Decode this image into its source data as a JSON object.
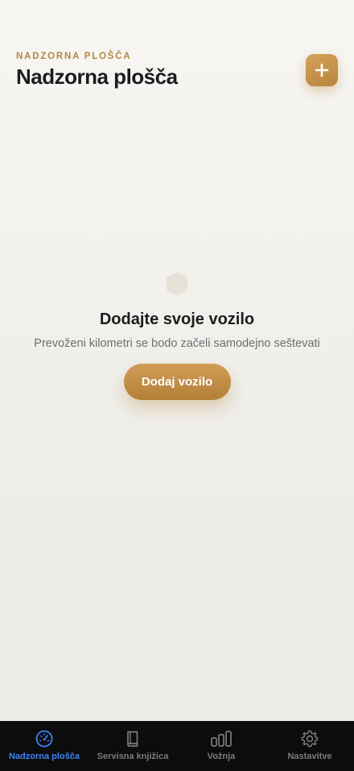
{
  "header": {
    "eyebrow": "NADZORNA PLOŠČA",
    "title": "Nadzorna plošča",
    "add_icon": "plus-icon"
  },
  "empty_state": {
    "icon": "hexagon-icon",
    "title": "Dodajte svoje vozilo",
    "subtitle": "Prevoženi kilometri se bodo začeli samodejno seštevati",
    "button_label": "Dodaj vozilo"
  },
  "tabbar": {
    "items": [
      {
        "label": "Nadzorna plošča",
        "icon": "speedometer-icon",
        "active": true
      },
      {
        "label": "Servisna knjižica",
        "icon": "book-icon",
        "active": false
      },
      {
        "label": "Vožnja",
        "icon": "bar-chart-icon",
        "active": false
      },
      {
        "label": "Nastavitve",
        "icon": "gear-icon",
        "active": false
      }
    ]
  },
  "colors": {
    "accent": "#c0904a",
    "active_tab": "#3d84f7",
    "inactive_tab": "#7c7c80",
    "tabbar_bg": "#0c0c0d"
  }
}
